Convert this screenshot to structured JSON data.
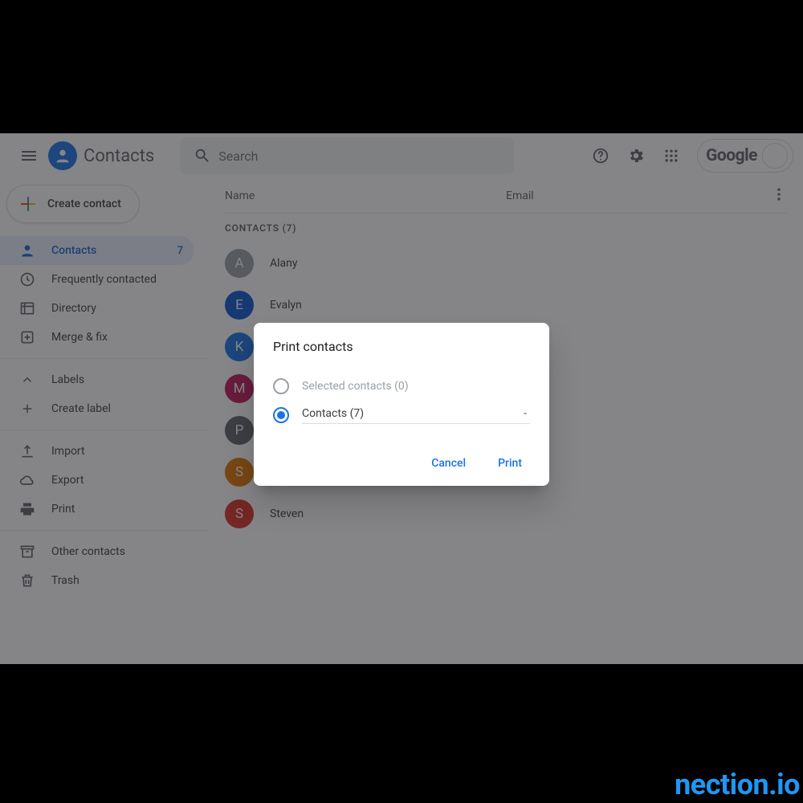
{
  "header": {
    "app_title": "Contacts",
    "search_placeholder": "Search",
    "google_label": "Google"
  },
  "sidebar": {
    "create_label": "Create contact",
    "items": {
      "contacts": {
        "label": "Contacts",
        "count": "7"
      },
      "frequent": {
        "label": "Frequently contacted"
      },
      "directory": {
        "label": "Directory"
      },
      "merge": {
        "label": "Merge & fix"
      },
      "labels": {
        "label": "Labels"
      },
      "create_label": {
        "label": "Create label"
      },
      "import": {
        "label": "Import"
      },
      "export": {
        "label": "Export"
      },
      "print": {
        "label": "Print"
      },
      "other": {
        "label": "Other contacts"
      },
      "trash": {
        "label": "Trash"
      }
    }
  },
  "list": {
    "col_name": "Name",
    "col_email": "Email",
    "group_label": "CONTACTS (7)",
    "rows": [
      {
        "initial": "A",
        "name": "Alany",
        "color": "#9aa0a6"
      },
      {
        "initial": "E",
        "name": "Evalyn",
        "color": "#0b57d0"
      },
      {
        "initial": "K",
        "name": "",
        "color": "#1a73e8"
      },
      {
        "initial": "M",
        "name": "",
        "color": "#c2185b"
      },
      {
        "initial": "P",
        "name": "",
        "color": "#5f6368"
      },
      {
        "initial": "S",
        "name": "",
        "color": "#e37400"
      },
      {
        "initial": "S",
        "name": "Steven",
        "color": "#d93025"
      }
    ]
  },
  "dialog": {
    "title": "Print contacts",
    "option_selected": "Selected contacts (0)",
    "option_contacts": "Contacts (7)",
    "cancel": "Cancel",
    "print": "Print"
  },
  "watermark": "nection.io"
}
